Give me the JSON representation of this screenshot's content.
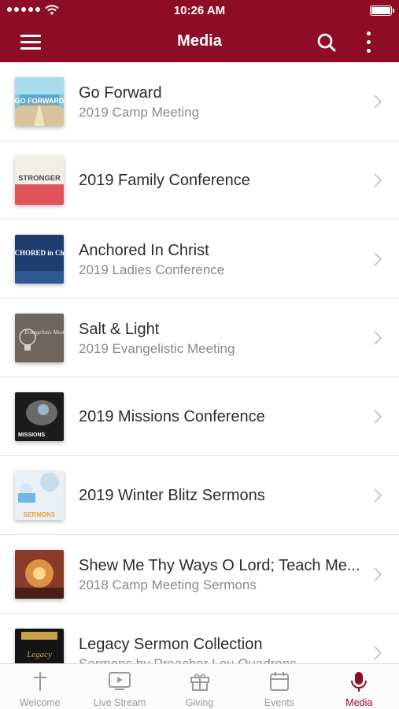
{
  "status_bar": {
    "time": "10:26 AM"
  },
  "header": {
    "title": "Media"
  },
  "colors": {
    "brand": "#8e0d26",
    "active_tab": "#8e0d26",
    "inactive_tab": "#9b9b9b",
    "subtitle": "#8a8a8a"
  },
  "icons": {
    "menu": "hamburger-menu-icon",
    "search": "search-icon",
    "more": "more-vertical-icon",
    "chevron": "chevron-right-icon"
  },
  "items": [
    {
      "title": "Go Forward",
      "subtitle": "2019 Camp Meeting",
      "thumb_text": "GO FORWARD"
    },
    {
      "title": "2019 Family Conference",
      "subtitle": "",
      "thumb_text": "STRONGER"
    },
    {
      "title": "Anchored In Christ",
      "subtitle": "2019 Ladies Conference",
      "thumb_text": "ANCHORED in Christ"
    },
    {
      "title": "Salt & Light",
      "subtitle": "2019 Evangelistic Meeting",
      "thumb_text": "Evangelistic Meeting"
    },
    {
      "title": "2019 Missions Conference",
      "subtitle": "",
      "thumb_text": "MISSIONS"
    },
    {
      "title": "2019 Winter Blitz Sermons",
      "subtitle": "",
      "thumb_text": "SERMONS"
    },
    {
      "title": "Shew Me Thy Ways O Lord; Teach Me...",
      "subtitle": "2018 Camp Meeting Sermons",
      "thumb_text": ""
    },
    {
      "title": "Legacy Sermon Collection",
      "subtitle": "Sermons by Preacher Lou Quadrons",
      "thumb_text": "Legacy"
    }
  ],
  "tabs": [
    {
      "label": "Welcome",
      "icon": "cross-icon",
      "active": false
    },
    {
      "label": "Live Stream",
      "icon": "tv-play-icon",
      "active": false
    },
    {
      "label": "Giving",
      "icon": "gift-icon",
      "active": false
    },
    {
      "label": "Events",
      "icon": "calendar-icon",
      "active": false
    },
    {
      "label": "Media",
      "icon": "microphone-icon",
      "active": true
    }
  ]
}
